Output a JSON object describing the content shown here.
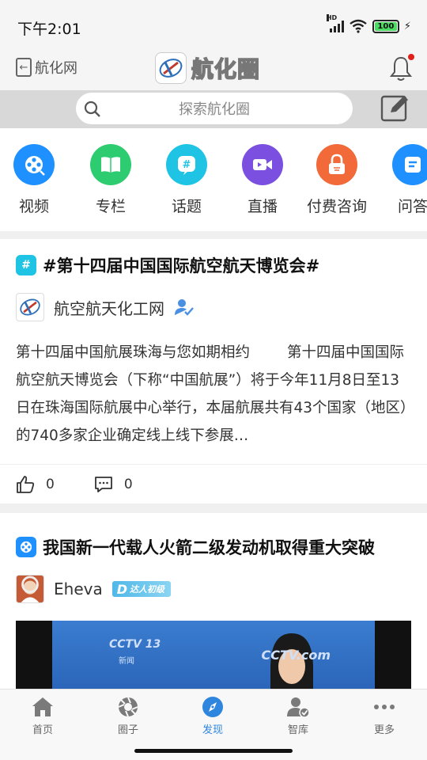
{
  "status": {
    "time": "下午2:01",
    "battery": "100"
  },
  "header": {
    "back_label": "航化网",
    "logo_text": "航化圈"
  },
  "search": {
    "placeholder": "探索航化圈"
  },
  "categories": [
    {
      "label": "视频",
      "color": "#1e90ff",
      "icon": "film-reel-icon"
    },
    {
      "label": "专栏",
      "color": "#2ecc71",
      "icon": "book-icon"
    },
    {
      "label": "话题",
      "color": "#1fc4e4",
      "icon": "hashtag-icon"
    },
    {
      "label": "直播",
      "color": "#7b4fe0",
      "icon": "video-camera-icon"
    },
    {
      "label": "付费咨询",
      "color": "#f26a3a",
      "icon": "lock-icon"
    },
    {
      "label": "问答",
      "color": "#1e90ff",
      "icon": "qa-icon"
    }
  ],
  "posts": [
    {
      "title": "#第十四届中国国际航空航天博览会#",
      "tag_color": "#1fc4e4",
      "tag_icon": "hashtag-icon",
      "author": "航空航天化工网",
      "verified_icon": "verified-user-icon",
      "body": "第十四届中国航展珠海与您如期相约        第十四届中国国际航空航天博览会（下称“中国航展”）将于今年11月8日至13日在珠海国际航展中心举行，本届航展共有43个国家（地区）的740多家企业确定线上线下参展…",
      "likes": "0",
      "comments": "0"
    },
    {
      "title": "我国新一代载人火箭二级发动机取得重大突破",
      "tag_color": "#1e90ff",
      "tag_icon": "film-reel-icon",
      "author": "Eheva",
      "level_badge": "达人初级",
      "video_channel": "CCTV 13",
      "video_sub": "新闻",
      "video_watermark": "CCTV.com"
    }
  ],
  "nav": [
    {
      "label": "首页",
      "icon": "home-icon",
      "active": false
    },
    {
      "label": "圈子",
      "icon": "aperture-icon",
      "active": false
    },
    {
      "label": "发现",
      "icon": "compass-icon",
      "active": true
    },
    {
      "label": "智库",
      "icon": "user-check-icon",
      "active": false
    },
    {
      "label": "更多",
      "icon": "more-dots-icon",
      "active": false
    }
  ]
}
